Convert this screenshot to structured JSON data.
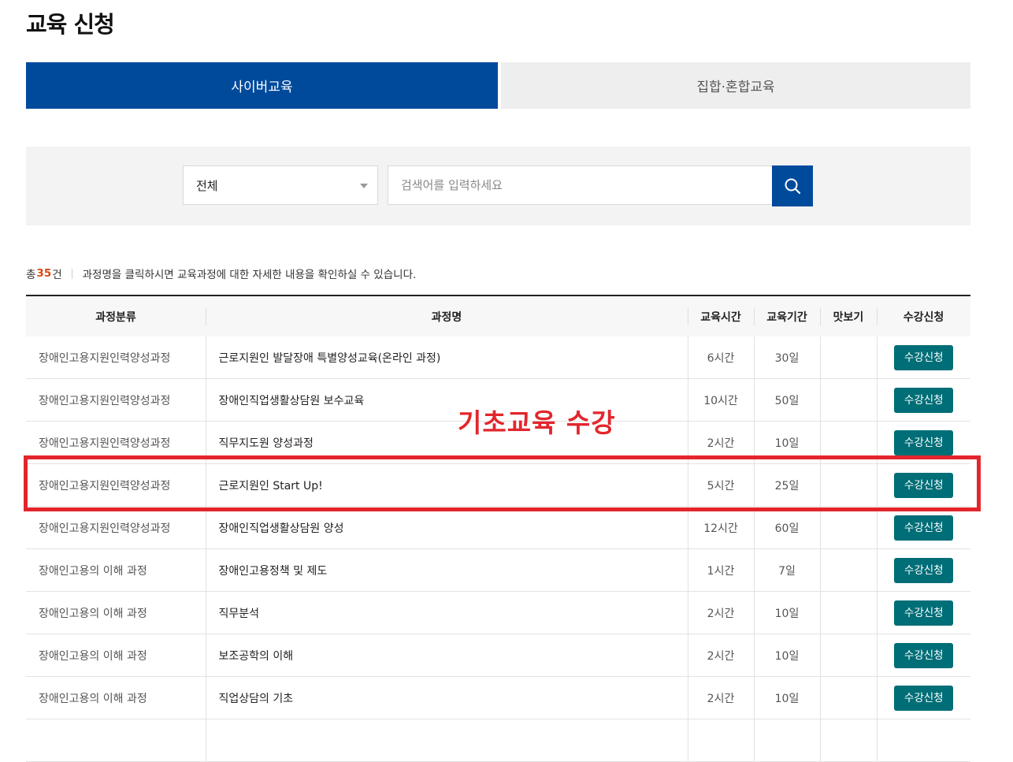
{
  "page": {
    "title": "교육 신청"
  },
  "tabs": [
    {
      "label": "사이버교육",
      "active": true
    },
    {
      "label": "집합·혼합교육",
      "active": false
    }
  ],
  "search": {
    "category": "전체",
    "placeholder": "검색어를 입력하세요",
    "value": "",
    "button_icon": "search-icon"
  },
  "summary": {
    "prefix": "총",
    "count": "35",
    "suffix": "건",
    "note": "과정명을 클릭하시면 교육과정에 대한 자세한 내용을 확인하실 수 있습니다."
  },
  "table": {
    "headers": [
      "과정분류",
      "과정명",
      "교육시간",
      "교육기간",
      "맛보기",
      "수강신청"
    ],
    "rows": [
      {
        "category": "장애인고용지원인력양성과정",
        "name": "근로지원인 발달장애 특별양성교육(온라인 과정)",
        "hours": "6시간",
        "period": "30일",
        "preview": "",
        "apply": "수강신청"
      },
      {
        "category": "장애인고용지원인력양성과정",
        "name": "장애인직업생활상담원 보수교육",
        "hours": "10시간",
        "period": "50일",
        "preview": "",
        "apply": "수강신청"
      },
      {
        "category": "장애인고용지원인력양성과정",
        "name": "직무지도원 양성과정",
        "hours": "2시간",
        "period": "10일",
        "preview": "",
        "apply": "수강신청"
      },
      {
        "category": "장애인고용지원인력양성과정",
        "name": "근로지원인 Start Up!",
        "hours": "5시간",
        "period": "25일",
        "preview": "",
        "apply": "수강신청"
      },
      {
        "category": "장애인고용지원인력양성과정",
        "name": "장애인직업생활상담원 양성",
        "hours": "12시간",
        "period": "60일",
        "preview": "",
        "apply": "수강신청"
      },
      {
        "category": "장애인고용의 이해 과정",
        "name": "장애인고용정책 및 제도",
        "hours": "1시간",
        "period": "7일",
        "preview": "",
        "apply": "수강신청"
      },
      {
        "category": "장애인고용의 이해 과정",
        "name": "직무분석",
        "hours": "2시간",
        "period": "10일",
        "preview": "",
        "apply": "수강신청"
      },
      {
        "category": "장애인고용의 이해 과정",
        "name": "보조공학의 이해",
        "hours": "2시간",
        "period": "10일",
        "preview": "",
        "apply": "수강신청"
      },
      {
        "category": "장애인고용의 이해 과정",
        "name": "직업상담의 기초",
        "hours": "2시간",
        "period": "10일",
        "preview": "",
        "apply": "수강신청"
      },
      {
        "category": "",
        "name": "",
        "hours": "",
        "period": "",
        "preview": "",
        "apply": ""
      }
    ]
  },
  "annotation": {
    "text": "기초교육 수강",
    "color": "#e3262d"
  },
  "colors": {
    "primary": "#004a9c",
    "button": "#006e77",
    "count": "#d9480f"
  }
}
